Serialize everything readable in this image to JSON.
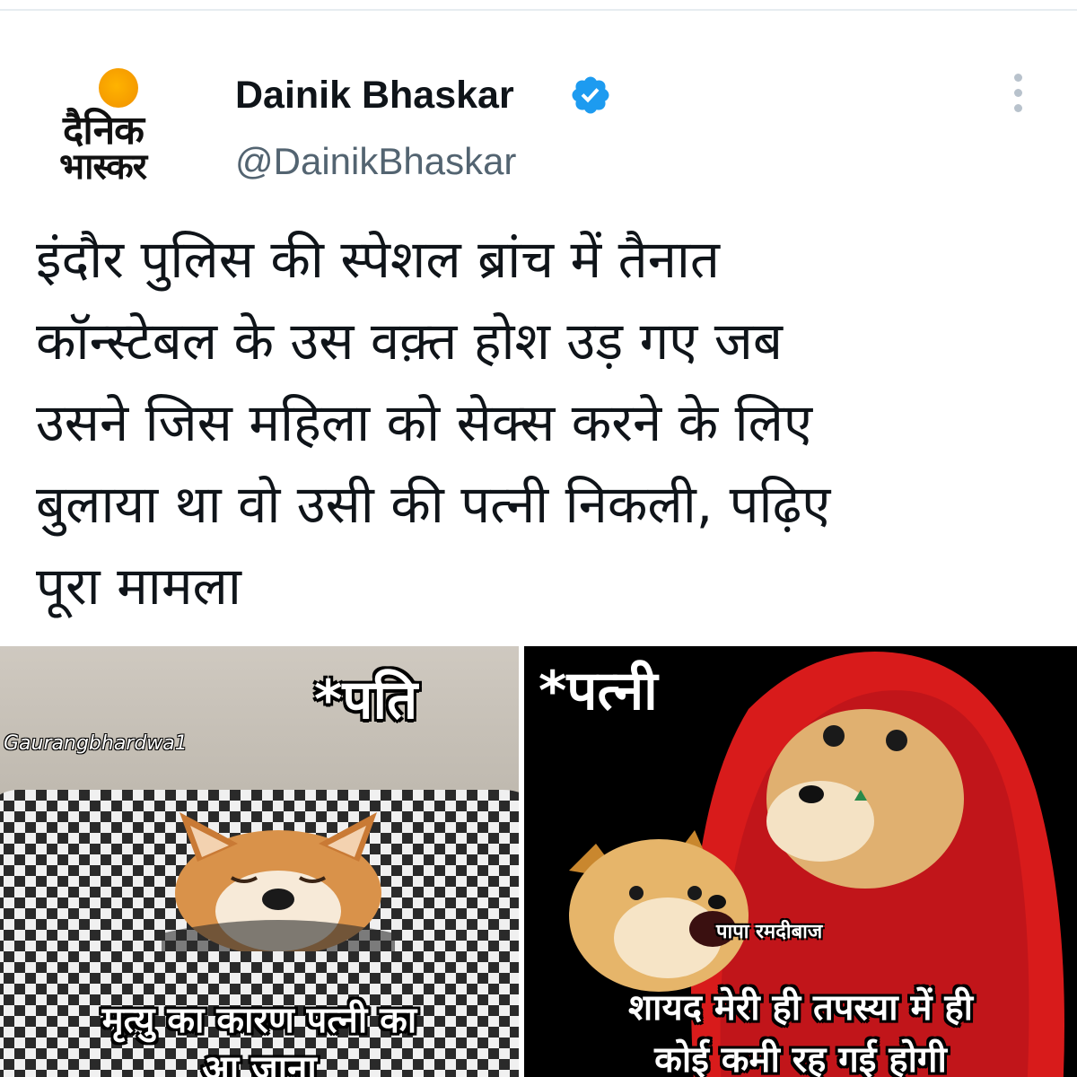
{
  "tweet": {
    "logo_text_line1": "दैनिक",
    "logo_text_line2": "भास्कर",
    "display_name": "Dainik Bhaskar",
    "handle": "@DainikBhaskar",
    "verified": true,
    "more_icon": "more-vertical-icon",
    "text_lines": [
      "इंदौर पुलिस की स्पेशल ब्रांच में तैनात",
      "कॉन्स्टेबल के उस वक़्त होश उड़ गए जब",
      "उसने जिस महिला को सेक्स करने के लिए",
      "बुलाया था वो उसी की पत्नी निकली, पढ़िए",
      "पूरा मामला"
    ]
  },
  "meme": {
    "left": {
      "heading": "*पति",
      "watermark": "Gaurangbhardwa1",
      "caption_line1": "मृत्यु का कारण पत्नी का",
      "caption_line2": "आ जाना"
    },
    "right": {
      "heading": "*पत्नी",
      "label": "पापा रमदीबाज",
      "caption_line1": "शायद मेरी ही तपस्या में ही",
      "caption_line2": "कोई कमी रह गई होगी"
    }
  },
  "colors": {
    "verified_blue": "#1d9bf0",
    "sun_orange": "#f59b00",
    "veil_red": "#d81b1b"
  }
}
